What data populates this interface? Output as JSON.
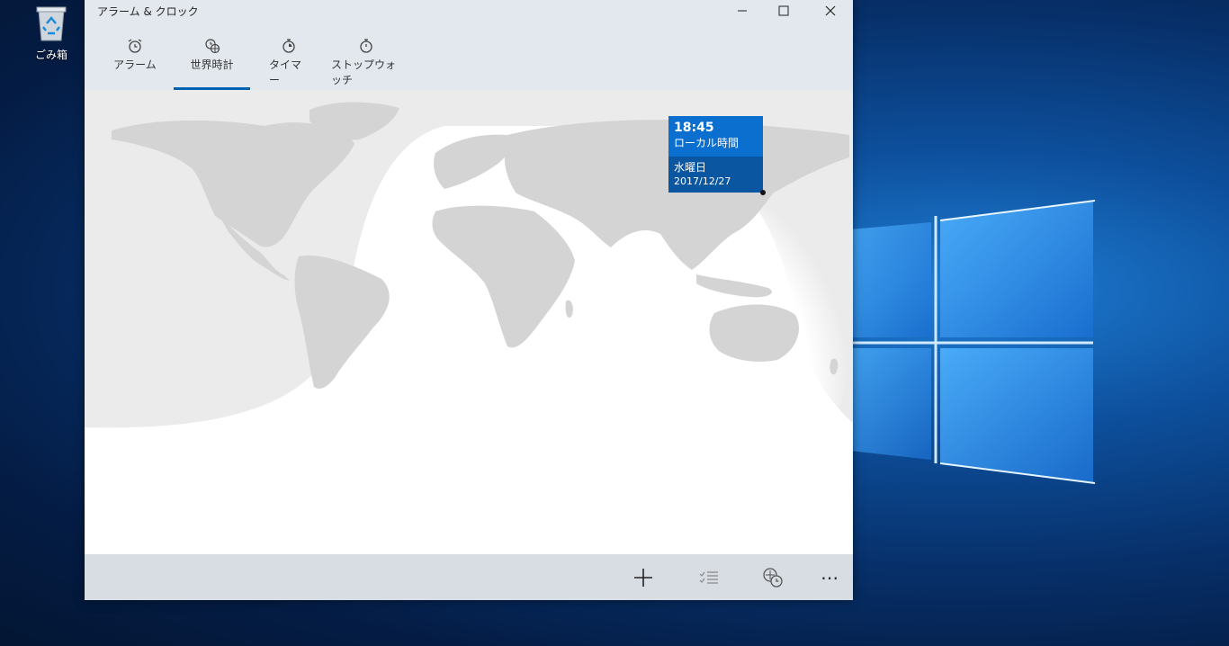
{
  "desktop": {
    "recycle_bin_label": "ごみ箱"
  },
  "window": {
    "title": "アラーム & クロック",
    "minimize_glyph": "—",
    "maximize_glyph": "☐",
    "close_glyph": "✕"
  },
  "tabs": [
    {
      "label": "アラーム",
      "icon": "alarm-clock-icon"
    },
    {
      "label": "世界時計",
      "icon": "world-clock-icon",
      "selected": true
    },
    {
      "label": "タイマー",
      "icon": "timer-icon"
    },
    {
      "label": "ストップウォッチ",
      "icon": "stopwatch-icon"
    }
  ],
  "tooltip": {
    "time": "18:45",
    "label": "ローカル時間",
    "day": "水曜日",
    "date": "2017/12/27"
  },
  "bottombar": {
    "add_icon": "plus-icon",
    "select_icon": "select-list-icon",
    "compare_icon": "compare-time-icon",
    "more_glyph": "⋯"
  },
  "colors": {
    "accent": "#0063b1",
    "tooltip_top": "#0a6fce",
    "tooltip_bottom": "#0b56a0",
    "chrome": "#e3e8ee",
    "bottombar": "#d8dde3"
  }
}
